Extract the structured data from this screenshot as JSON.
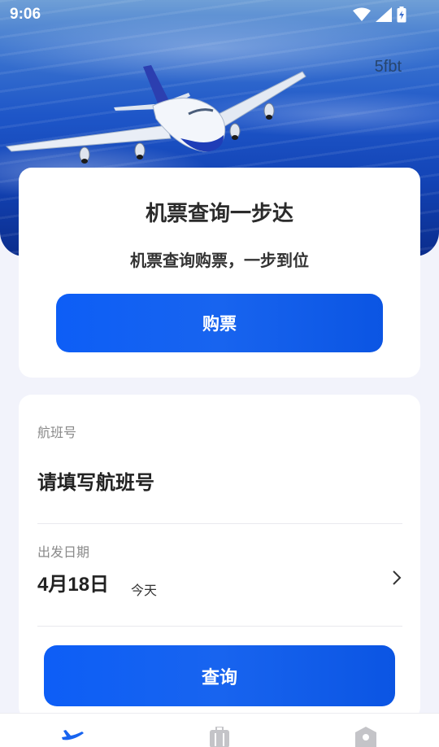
{
  "status_bar": {
    "time": "9:06",
    "icons": [
      "wifi-icon",
      "cell-signal-icon",
      "battery-charging-icon"
    ]
  },
  "hero": {
    "tag": "5fbt",
    "image": "airplane-over-clouds"
  },
  "promo_card": {
    "title": "机票查询一步达",
    "subtitle": "机票查询购票，一步到位",
    "buy_button": "购票"
  },
  "search_card": {
    "flight_label": "航班号",
    "flight_placeholder": "请填写航班号",
    "date_label": "出发日期",
    "date_value": "4月18日",
    "date_relative": "今天",
    "query_button": "查询"
  },
  "bottom_nav": {
    "items": [
      {
        "icon": "airplane-icon",
        "active": true
      },
      {
        "icon": "luggage-icon",
        "active": false
      },
      {
        "icon": "profile-icon",
        "active": false
      }
    ]
  },
  "colors": {
    "accent": "#1864ef",
    "background": "#f2f3fb",
    "card": "#ffffff",
    "nav_inactive": "#c4c4c8"
  }
}
